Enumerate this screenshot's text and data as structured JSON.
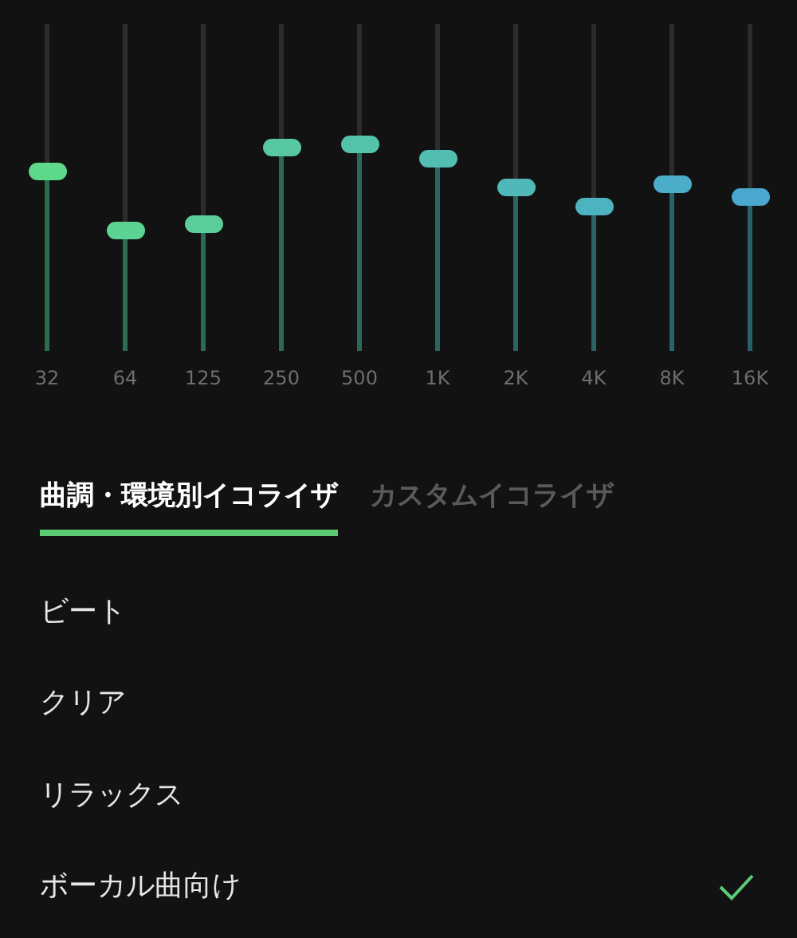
{
  "bands": [
    {
      "label": "32",
      "level": 0.55
    },
    {
      "label": "64",
      "level": 0.37
    },
    {
      "label": "125",
      "level": 0.39
    },
    {
      "label": "250",
      "level": 0.62
    },
    {
      "label": "500",
      "level": 0.63
    },
    {
      "label": "1K",
      "level": 0.59
    },
    {
      "label": "2K",
      "level": 0.5
    },
    {
      "label": "4K",
      "level": 0.44
    },
    {
      "label": "8K",
      "level": 0.51
    },
    {
      "label": "16K",
      "level": 0.47
    }
  ],
  "tabs": [
    {
      "label": "曲調・環境別イコライザ",
      "selected": true
    },
    {
      "label": "カスタムイコライザ",
      "selected": false
    }
  ],
  "presets": [
    {
      "label": "ビート",
      "selected": false
    },
    {
      "label": "クリア",
      "selected": false
    },
    {
      "label": "リラックス",
      "selected": false
    },
    {
      "label": "ボーカル曲向け",
      "selected": true
    }
  ]
}
